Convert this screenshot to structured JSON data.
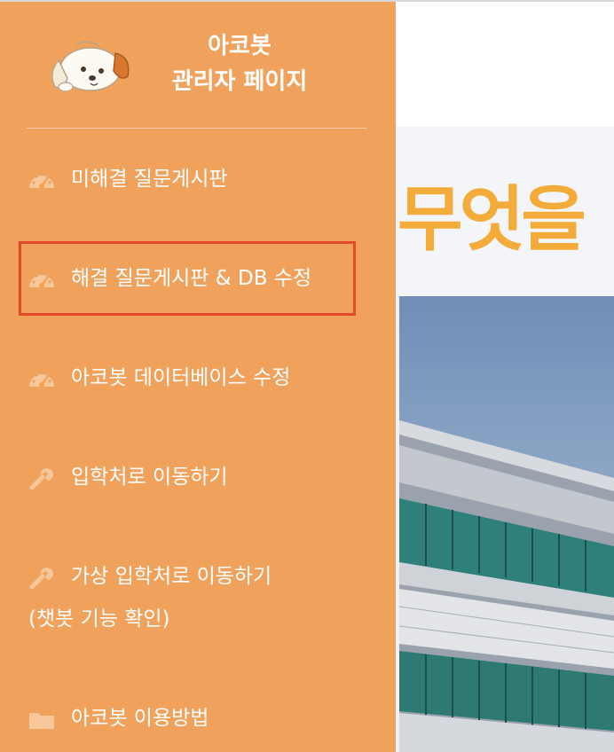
{
  "sidebar": {
    "brand": {
      "line1": "아코봇",
      "line2": "관리자 페이지"
    },
    "items": [
      {
        "label": "미해결 질문게시판",
        "icon": "dashboard-icon"
      },
      {
        "label": "해결 질문게시판 & DB 수정",
        "icon": "dashboard-icon",
        "highlighted": true
      },
      {
        "label": "아코봇 데이터베이스 수정",
        "icon": "dashboard-icon"
      },
      {
        "label": "입학처로 이동하기",
        "icon": "wrench-icon"
      },
      {
        "label": "가상 입학처로 이동하기",
        "sub_label": "(챗봇 기능 확인)",
        "icon": "wrench-icon"
      },
      {
        "label": "아코봇 이용방법",
        "icon": "folder-icon"
      }
    ]
  },
  "main": {
    "hero_text": "무엇을"
  },
  "colors": {
    "sidebar_bg": "#f0a25d",
    "highlight_border": "#e24a2a",
    "hero_text": "#f3ab3a",
    "icon_tint": "#f9d9b8"
  }
}
